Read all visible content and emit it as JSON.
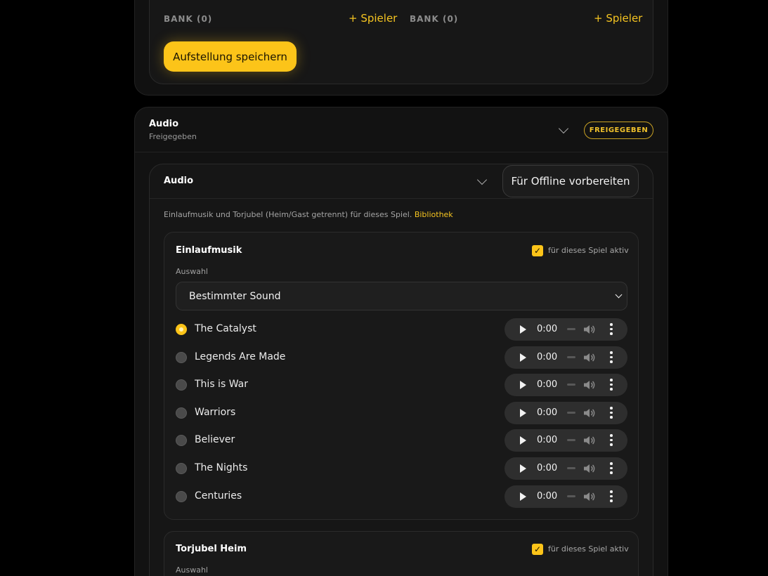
{
  "lineup": {
    "bank_left_label": "BANK (0)",
    "bank_right_label": "BANK (0)",
    "add_player_label": "+ Spieler",
    "save_label": "Aufstellung speichern"
  },
  "audio_section": {
    "title": "Audio",
    "subtitle": "Freigegeben",
    "badge": "FREIGEGEBEN",
    "panel_title": "Audio",
    "offline_button": "Für Offline vorbereiten",
    "description": "Einlaufmusik und Torjubel (Heim/Gast getrennt) für dieses Spiel.",
    "library_link": "Bibliothek"
  },
  "entrance_music": {
    "title": "Einlaufmusik",
    "active_label": "für dieses Spiel aktiv",
    "selection_label": "Auswahl",
    "selection_value": "Bestimmter Sound",
    "tracks": [
      {
        "name": "The Catalyst",
        "time": "0:00",
        "selected": true
      },
      {
        "name": "Legends Are Made",
        "time": "0:00",
        "selected": false
      },
      {
        "name": "This is War",
        "time": "0:00",
        "selected": false
      },
      {
        "name": "Warriors",
        "time": "0:00",
        "selected": false
      },
      {
        "name": "Believer",
        "time": "0:00",
        "selected": false
      },
      {
        "name": "The Nights",
        "time": "0:00",
        "selected": false
      },
      {
        "name": "Centuries",
        "time": "0:00",
        "selected": false
      }
    ]
  },
  "home_goal": {
    "title": "Torjubel Heim",
    "active_label": "für dieses Spiel aktiv",
    "selection_label": "Auswahl"
  },
  "colors": {
    "accent": "#fcc419",
    "background": "#000000",
    "card": "#161616"
  }
}
